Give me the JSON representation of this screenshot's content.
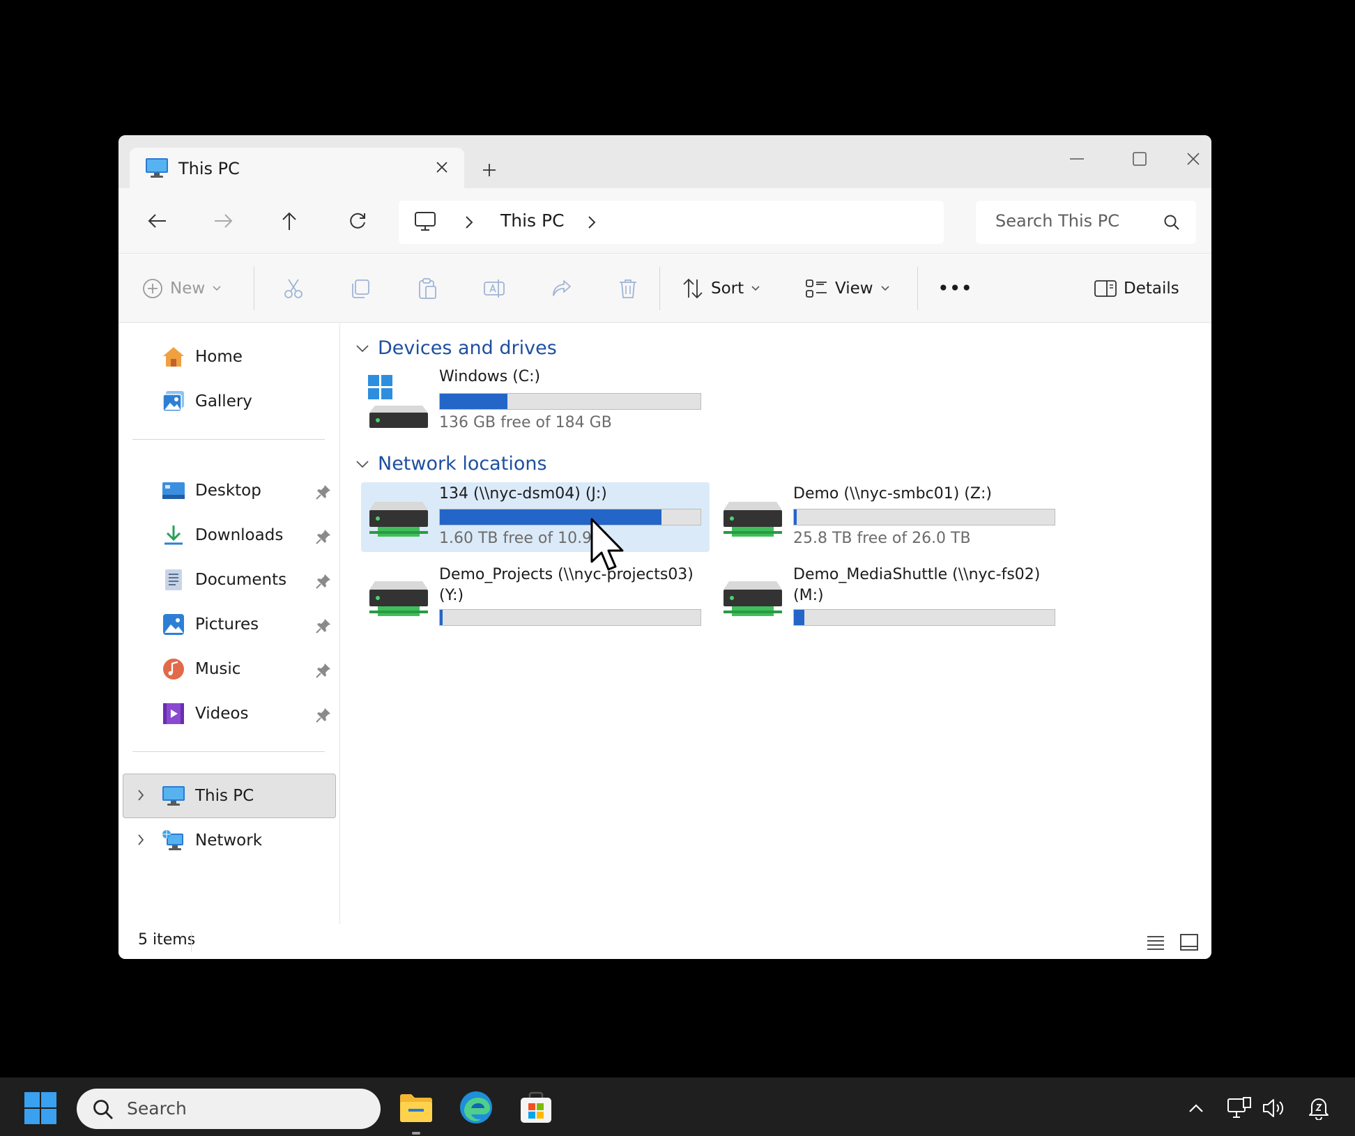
{
  "window": {
    "tab_title": "This PC",
    "breadcrumb": "This PC",
    "search_placeholder": "Search This PC"
  },
  "toolbar": {
    "new_label": "New",
    "sort_label": "Sort",
    "view_label": "View",
    "more_label": "•••",
    "details_label": "Details"
  },
  "sidebar": {
    "top": [
      {
        "label": "Home",
        "icon": "home-icon"
      },
      {
        "label": "Gallery",
        "icon": "gallery-icon"
      }
    ],
    "pinned": [
      {
        "label": "Desktop",
        "icon": "desktop-icon"
      },
      {
        "label": "Downloads",
        "icon": "downloads-icon"
      },
      {
        "label": "Documents",
        "icon": "documents-icon"
      },
      {
        "label": "Pictures",
        "icon": "pictures-icon"
      },
      {
        "label": "Music",
        "icon": "music-icon"
      },
      {
        "label": "Videos",
        "icon": "videos-icon"
      }
    ],
    "bottom": [
      {
        "label": "This PC",
        "icon": "this-pc-icon",
        "selected": true
      },
      {
        "label": "Network",
        "icon": "network-icon"
      }
    ]
  },
  "content": {
    "devices_header": "Devices and drives",
    "network_header": "Network locations",
    "devices": [
      {
        "name": "Windows (C:)",
        "free": "136 GB free of 184 GB",
        "used_fraction": 0.26
      }
    ],
    "network": [
      {
        "name": "134 (\\\\nyc-dsm04) (J:)",
        "free": "1.60 TB free of 10.9 T",
        "used_fraction": 0.85,
        "selected": true
      },
      {
        "name": "Demo (\\\\nyc-smbc01) (Z:)",
        "free": "25.8 TB free of 26.0 TB",
        "used_fraction": 0.01
      },
      {
        "name": "Demo_Projects (\\\\nyc-projects03) (Y:)",
        "free": "",
        "used_fraction": 0.01
      },
      {
        "name": "Demo_MediaShuttle (\\\\nyc-fs02) (M:)",
        "free": "",
        "used_fraction": 0.04
      }
    ]
  },
  "status": {
    "items_count": "5 items"
  },
  "taskbar": {
    "search_label": "Search",
    "apps": [
      "file-explorer-icon",
      "edge-icon",
      "store-icon"
    ]
  },
  "colors": {
    "accent": "#2465c8",
    "header_blue": "#1e4fa0",
    "selection": "#dbeaf8"
  }
}
